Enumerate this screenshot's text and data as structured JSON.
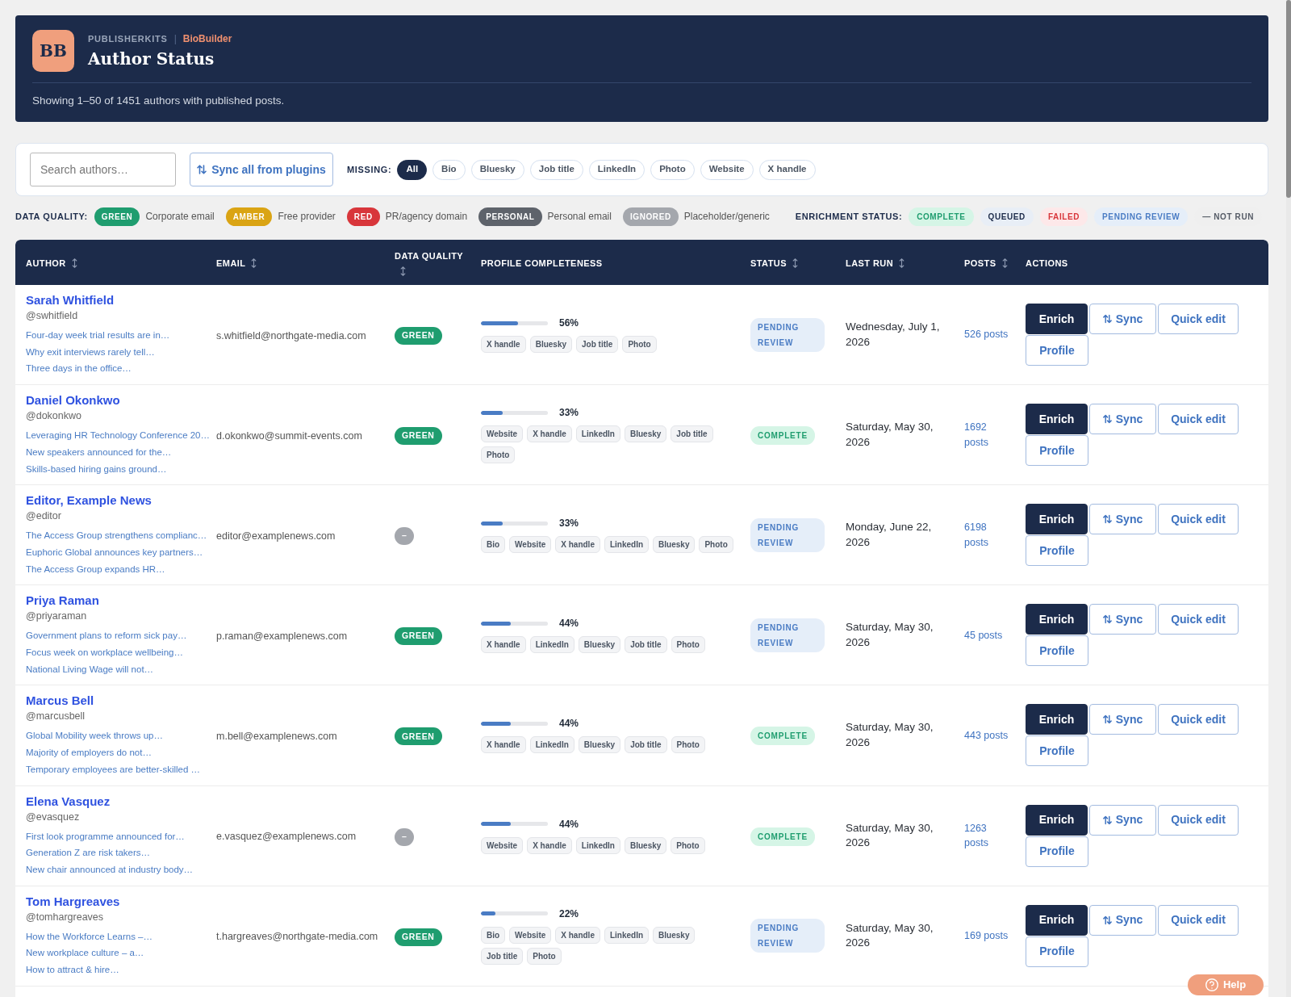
{
  "header": {
    "logo": "BB",
    "org": "PUBLISHERKITS",
    "separator": "|",
    "app": "BioBuilder",
    "title": "Author Status",
    "summary": "Showing 1–50 of 1451 authors with published posts."
  },
  "toolbar": {
    "search": {
      "placeholder": "Search authors…"
    },
    "sync_button": "Sync all from plugins",
    "missing_label": "MISSING:",
    "missing_filters": [
      {
        "label": "All",
        "selected": true
      },
      {
        "label": "Bio",
        "selected": false
      },
      {
        "label": "Bluesky",
        "selected": false
      },
      {
        "label": "Job title",
        "selected": false
      },
      {
        "label": "LinkedIn",
        "selected": false
      },
      {
        "label": "Photo",
        "selected": false
      },
      {
        "label": "Website",
        "selected": false
      },
      {
        "label": "X handle",
        "selected": false
      }
    ]
  },
  "legends": {
    "data_quality": {
      "label": "DATA QUALITY:",
      "items": [
        {
          "badge": "GREEN",
          "color": "#1f9d6f",
          "description": "Corporate email"
        },
        {
          "badge": "AMBER",
          "color": "#daa414",
          "description": "Free provider"
        },
        {
          "badge": "RED",
          "color": "#d8363b",
          "description": "PR/agency domain"
        },
        {
          "badge": "PERSONAL",
          "color": "#5e636b",
          "description": "Personal email"
        },
        {
          "badge": "IGNORED",
          "color": "#a4a7ad",
          "description": "Placeholder/generic"
        }
      ]
    },
    "enrichment_status": {
      "label": "ENRICHMENT STATUS:",
      "items": [
        {
          "badge": "COMPLETE",
          "kind": "complete"
        },
        {
          "badge": "QUEUED",
          "kind": "queued"
        },
        {
          "badge": "FAILED",
          "kind": "failed"
        },
        {
          "badge": "PENDING REVIEW",
          "kind": "pending_review"
        },
        {
          "badge": "— NOT RUN",
          "kind": "not_run"
        }
      ]
    }
  },
  "table": {
    "columns": [
      {
        "label": "AUTHOR",
        "sortable": true
      },
      {
        "label": "EMAIL",
        "sortable": true
      },
      {
        "label": "DATA QUALITY",
        "sortable": true
      },
      {
        "label": "PROFILE COMPLETENESS",
        "sortable": false
      },
      {
        "label": "STATUS",
        "sortable": true
      },
      {
        "label": "LAST RUN",
        "sortable": true
      },
      {
        "label": "POSTS",
        "sortable": true
      },
      {
        "label": "ACTIONS",
        "sortable": false
      }
    ],
    "rows": [
      {
        "author": {
          "name": "Sarah Whitfield",
          "handle": "@swhitfield",
          "recent_posts": [
            "Four-day week trial results are in…",
            "Why exit interviews rarely tell…",
            "Three days in the office…"
          ]
        },
        "email": "s.whitfield@northgate-media.com",
        "data_quality": {
          "text": "GREEN",
          "color": "#1f9d6f"
        },
        "completeness": {
          "level": 0.56,
          "reading": "56%",
          "missing": [
            "X handle",
            "Bluesky",
            "Job title",
            "Photo"
          ]
        },
        "status": {
          "text": "PENDING REVIEW",
          "kind": "pending_review"
        },
        "last_run": "Wednesday, July 1, 2026",
        "posts": "526 posts",
        "actions": [
          {
            "label": "Enrich",
            "kind": "enrich"
          },
          {
            "label": "Sync",
            "kind": "sync"
          },
          {
            "label": "Quick edit",
            "kind": "quick_edit"
          },
          {
            "label": "Profile",
            "kind": "profile"
          }
        ]
      },
      {
        "author": {
          "name": "Daniel Okonkwo",
          "handle": "@dokonkwo",
          "recent_posts": [
            "Leveraging HR Technology Conference 20…",
            "New speakers announced for the…",
            "Skills-based hiring gains ground…"
          ]
        },
        "email": "d.okonkwo@summit-events.com",
        "data_quality": {
          "text": "GREEN",
          "color": "#1f9d6f"
        },
        "completeness": {
          "level": 0.33,
          "reading": "33%",
          "missing": [
            "Website",
            "X handle",
            "LinkedIn",
            "Bluesky",
            "Job title",
            "Photo"
          ]
        },
        "status": {
          "text": "COMPLETE",
          "kind": "complete"
        },
        "last_run": "Saturday, May 30, 2026",
        "posts": "1692 posts",
        "actions": [
          {
            "label": "Enrich",
            "kind": "enrich"
          },
          {
            "label": "Sync",
            "kind": "sync"
          },
          {
            "label": "Quick edit",
            "kind": "quick_edit"
          },
          {
            "label": "Profile",
            "kind": "profile"
          }
        ]
      },
      {
        "author": {
          "name": "Editor, Example News",
          "handle": "@editor",
          "recent_posts": [
            "The Access Group strengthens complianc…",
            "Euphoric Global announces key partners…",
            "The Access Group expands HR…"
          ]
        },
        "email": "editor@examplenews.com",
        "data_quality": {
          "text": "–",
          "color": "#a4a7ad"
        },
        "completeness": {
          "level": 0.33,
          "reading": "33%",
          "missing": [
            "Bio",
            "Website",
            "X handle",
            "LinkedIn",
            "Bluesky",
            "Photo"
          ]
        },
        "status": {
          "text": "PENDING REVIEW",
          "kind": "pending_review"
        },
        "last_run": "Monday, June 22, 2026",
        "posts": "6198 posts",
        "actions": [
          {
            "label": "Enrich",
            "kind": "enrich"
          },
          {
            "label": "Sync",
            "kind": "sync"
          },
          {
            "label": "Quick edit",
            "kind": "quick_edit"
          },
          {
            "label": "Profile",
            "kind": "profile"
          }
        ]
      },
      {
        "author": {
          "name": "Priya Raman",
          "handle": "@priyaraman",
          "recent_posts": [
            "Government plans to reform sick pay…",
            "Focus week on workplace wellbeing…",
            "National Living Wage will not…"
          ]
        },
        "email": "p.raman@examplenews.com",
        "data_quality": {
          "text": "GREEN",
          "color": "#1f9d6f"
        },
        "completeness": {
          "level": 0.44,
          "reading": "44%",
          "missing": [
            "X handle",
            "LinkedIn",
            "Bluesky",
            "Job title",
            "Photo"
          ]
        },
        "status": {
          "text": "PENDING REVIEW",
          "kind": "pending_review"
        },
        "last_run": "Saturday, May 30, 2026",
        "posts": "45 posts",
        "actions": [
          {
            "label": "Enrich",
            "kind": "enrich"
          },
          {
            "label": "Sync",
            "kind": "sync"
          },
          {
            "label": "Quick edit",
            "kind": "quick_edit"
          },
          {
            "label": "Profile",
            "kind": "profile"
          }
        ]
      },
      {
        "author": {
          "name": "Marcus Bell",
          "handle": "@marcusbell",
          "recent_posts": [
            "Global Mobility week throws up…",
            "Majority of employers do not…",
            "Temporary employees are better-skilled …"
          ]
        },
        "email": "m.bell@examplenews.com",
        "data_quality": {
          "text": "GREEN",
          "color": "#1f9d6f"
        },
        "completeness": {
          "level": 0.44,
          "reading": "44%",
          "missing": [
            "X handle",
            "LinkedIn",
            "Bluesky",
            "Job title",
            "Photo"
          ]
        },
        "status": {
          "text": "COMPLETE",
          "kind": "complete"
        },
        "last_run": "Saturday, May 30, 2026",
        "posts": "443 posts",
        "actions": [
          {
            "label": "Enrich",
            "kind": "enrich"
          },
          {
            "label": "Sync",
            "kind": "sync"
          },
          {
            "label": "Quick edit",
            "kind": "quick_edit"
          },
          {
            "label": "Profile",
            "kind": "profile"
          }
        ]
      },
      {
        "author": {
          "name": "Elena Vasquez",
          "handle": "@evasquez",
          "recent_posts": [
            "First look programme announced for…",
            "Generation Z are risk takers…",
            "New chair announced at industry body…"
          ]
        },
        "email": "e.vasquez@examplenews.com",
        "data_quality": {
          "text": "–",
          "color": "#a4a7ad"
        },
        "completeness": {
          "level": 0.44,
          "reading": "44%",
          "missing": [
            "Website",
            "X handle",
            "LinkedIn",
            "Bluesky",
            "Photo"
          ]
        },
        "status": {
          "text": "COMPLETE",
          "kind": "complete"
        },
        "last_run": "Saturday, May 30, 2026",
        "posts": "1263 posts",
        "actions": [
          {
            "label": "Enrich",
            "kind": "enrich"
          },
          {
            "label": "Sync",
            "kind": "sync"
          },
          {
            "label": "Quick edit",
            "kind": "quick_edit"
          },
          {
            "label": "Profile",
            "kind": "profile"
          }
        ]
      },
      {
        "author": {
          "name": "Tom Hargreaves",
          "handle": "@tomhargreaves",
          "recent_posts": [
            "How the Workforce Learns –…",
            "New workplace culture – a…",
            "How to attract & hire…"
          ]
        },
        "email": "t.hargreaves@northgate-media.com",
        "data_quality": {
          "text": "GREEN",
          "color": "#1f9d6f"
        },
        "completeness": {
          "level": 0.22,
          "reading": "22%",
          "missing": [
            "Bio",
            "Website",
            "X handle",
            "LinkedIn",
            "Bluesky",
            "Job title",
            "Photo"
          ]
        },
        "status": {
          "text": "PENDING REVIEW",
          "kind": "pending_review"
        },
        "last_run": "Saturday, May 30, 2026",
        "posts": "169 posts",
        "actions": [
          {
            "label": "Enrich",
            "kind": "enrich"
          },
          {
            "label": "Sync",
            "kind": "sync"
          },
          {
            "label": "Quick edit",
            "kind": "quick_edit"
          },
          {
            "label": "Profile",
            "kind": "profile"
          }
        ]
      }
    ]
  },
  "help_button": {
    "label": "Help"
  }
}
